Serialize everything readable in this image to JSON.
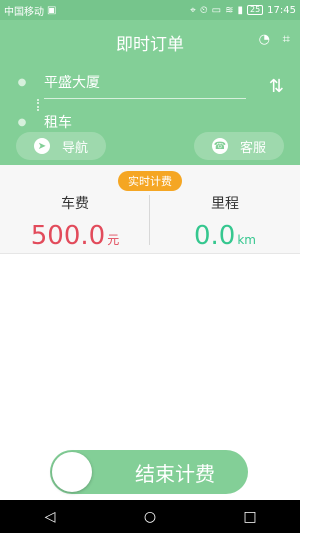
{
  "status": {
    "carrier": "中国移动",
    "battery": "25",
    "time": "17:45"
  },
  "header": {
    "title": "即时订单"
  },
  "route": {
    "from": "平盛大厦",
    "to": "租车"
  },
  "buttons": {
    "navigate": "导航",
    "service": "客服"
  },
  "billing": {
    "badge": "实时计费",
    "fee_label": "车费",
    "fee_value": "500.0",
    "fee_unit": "元",
    "distance_label": "里程",
    "distance_value": "0.0",
    "distance_unit": "km"
  },
  "end": {
    "label": "结束计费"
  },
  "colors": {
    "primary_green": "#83cf97",
    "fee_red": "#e24b5b",
    "distance_green": "#35c78f",
    "badge_orange": "#f5a623"
  }
}
